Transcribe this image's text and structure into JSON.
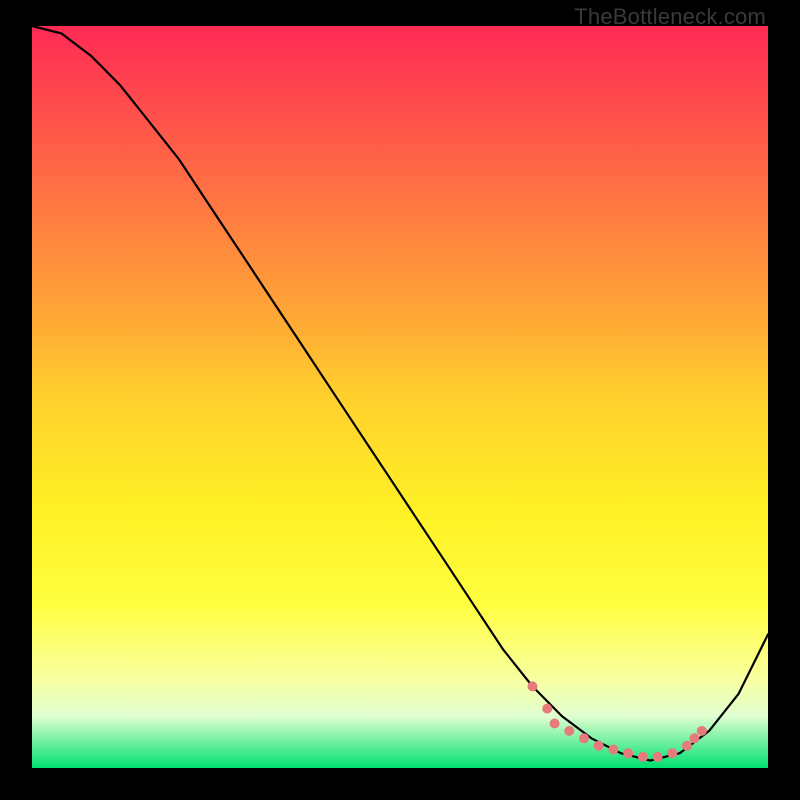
{
  "watermark": "TheBottleneck.com",
  "chart_data": {
    "type": "line",
    "title": "",
    "xlabel": "",
    "ylabel": "",
    "xlim": [
      0,
      100
    ],
    "ylim": [
      0,
      100
    ],
    "curve": {
      "x": [
        0,
        4,
        8,
        12,
        16,
        20,
        24,
        28,
        32,
        36,
        40,
        44,
        48,
        52,
        56,
        60,
        64,
        68,
        72,
        76,
        80,
        84,
        88,
        92,
        96,
        100
      ],
      "y": [
        100,
        99,
        96,
        92,
        87,
        82,
        76,
        70,
        64,
        58,
        52,
        46,
        40,
        34,
        28,
        22,
        16,
        11,
        7,
        4,
        2,
        1,
        2,
        5,
        10,
        18
      ]
    },
    "highlight_markers": {
      "color": "#e77b7b",
      "radius": 5,
      "points": [
        {
          "x": 68,
          "y": 11
        },
        {
          "x": 70,
          "y": 8
        },
        {
          "x": 71,
          "y": 6
        },
        {
          "x": 73,
          "y": 5
        },
        {
          "x": 75,
          "y": 4
        },
        {
          "x": 77,
          "y": 3
        },
        {
          "x": 79,
          "y": 2.5
        },
        {
          "x": 81,
          "y": 2
        },
        {
          "x": 83,
          "y": 1.5
        },
        {
          "x": 85,
          "y": 1.5
        },
        {
          "x": 87,
          "y": 2
        },
        {
          "x": 89,
          "y": 3
        },
        {
          "x": 90,
          "y": 4
        },
        {
          "x": 91,
          "y": 5
        }
      ]
    }
  },
  "colors": {
    "marker": "#e77b7b",
    "curve": "#000000",
    "frame": "#000000"
  }
}
